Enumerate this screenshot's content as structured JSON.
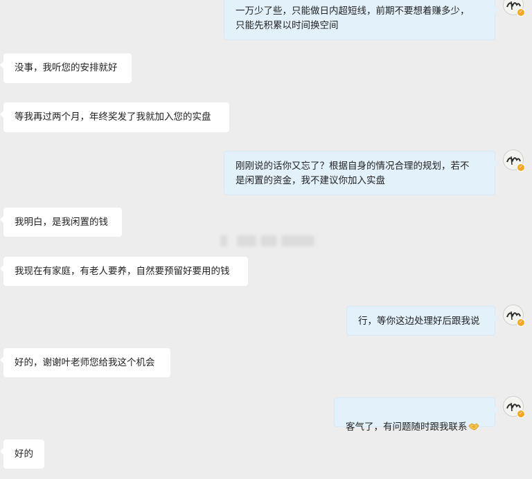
{
  "messages": [
    {
      "side": "right",
      "text": "一万少了些，只能做日内超短线，前期不要想着赚多少，\n只能先积累以时间换空间"
    },
    {
      "side": "left",
      "text": "没事，我听您的安排就好"
    },
    {
      "side": "left",
      "text": "等我再过两个月，年终奖发了我就加入您的实盘"
    },
    {
      "side": "right",
      "text": "刚刚说的话你又忘了？根据自身的情况合理的规划，若不\n是闲置的资金，我不建议你加入实盘"
    },
    {
      "side": "left",
      "text": "我明白，是我闲置的钱"
    },
    {
      "side": "left",
      "text": "我现在有家庭，有老人要养，自然要预留好要用的钱"
    },
    {
      "side": "right",
      "text": "行，等你这边处理好后跟我说"
    },
    {
      "side": "left",
      "text": "好的，谢谢叶老师您给我这个机会"
    },
    {
      "side": "right",
      "text": "客气了，有问题随时跟我联系",
      "emoji": "handshake-emoji"
    },
    {
      "side": "left",
      "text": "好的"
    }
  ],
  "avatar": {
    "badge": "✓",
    "badge_color": "#f5a623"
  },
  "colors": {
    "background": "#ededed",
    "incoming_bubble": "#ffffff",
    "outgoing_bubble": "#e3f1fb"
  }
}
